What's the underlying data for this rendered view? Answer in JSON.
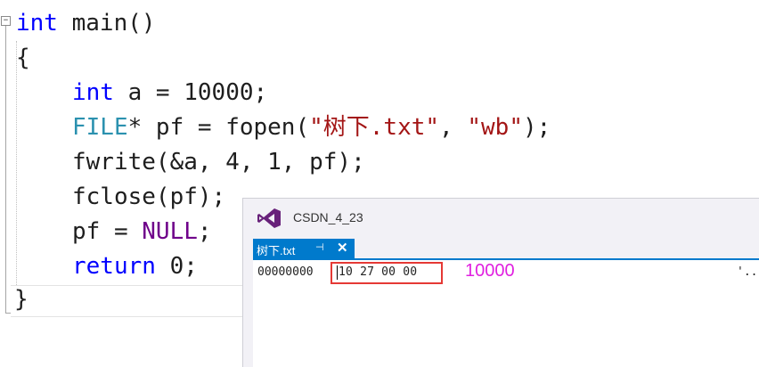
{
  "editor": {
    "lines": [
      {
        "parts": [
          {
            "t": "int",
            "c": "kw"
          },
          {
            "t": " main()",
            "c": ""
          }
        ]
      },
      {
        "parts": [
          {
            "t": "{",
            "c": ""
          }
        ]
      },
      {
        "parts": [
          {
            "t": "int",
            "c": "kw"
          },
          {
            "t": " a = 10000;",
            "c": ""
          }
        ]
      },
      {
        "parts": [
          {
            "t": "FILE",
            "c": "ty"
          },
          {
            "t": "* pf = fopen(",
            "c": ""
          },
          {
            "t": "\"树下.txt\"",
            "c": "str"
          },
          {
            "t": ", ",
            "c": ""
          },
          {
            "t": "\"wb\"",
            "c": "str"
          },
          {
            "t": ");",
            "c": ""
          }
        ]
      },
      {
        "parts": [
          {
            "t": "fwrite(&a, 4, 1, pf);",
            "c": ""
          }
        ]
      },
      {
        "parts": [
          {
            "t": "fclose(pf);",
            "c": ""
          }
        ]
      },
      {
        "parts": [
          {
            "t": "pf = ",
            "c": ""
          },
          {
            "t": "NULL",
            "c": "mac"
          },
          {
            "t": ";",
            "c": ""
          }
        ]
      },
      {
        "parts": [
          {
            "t": "return",
            "c": "kw"
          },
          {
            "t": " 0;",
            "c": ""
          }
        ]
      },
      {
        "parts": [
          {
            "t": "}",
            "c": ""
          }
        ]
      }
    ],
    "fold_glyph": "−"
  },
  "hex_window": {
    "title": "CSDN_4_23",
    "tab": {
      "label": "树下.txt",
      "pin_glyph": "⊣",
      "close_glyph": "✕"
    },
    "row": {
      "offset": "00000000",
      "bytes": "10 27 00 00",
      "ascii": "'.."
    },
    "annotation": "10000"
  },
  "colors": {
    "keyword": "#0000ff",
    "type": "#2b91af",
    "string": "#a31515",
    "macro": "#6f008a",
    "accent": "#007acc",
    "highlight": "#e53935",
    "annotation": "#e020e0"
  },
  "icons": [
    "visual-studio-logo-icon",
    "pin-icon",
    "close-icon",
    "fold-toggle-icon"
  ]
}
